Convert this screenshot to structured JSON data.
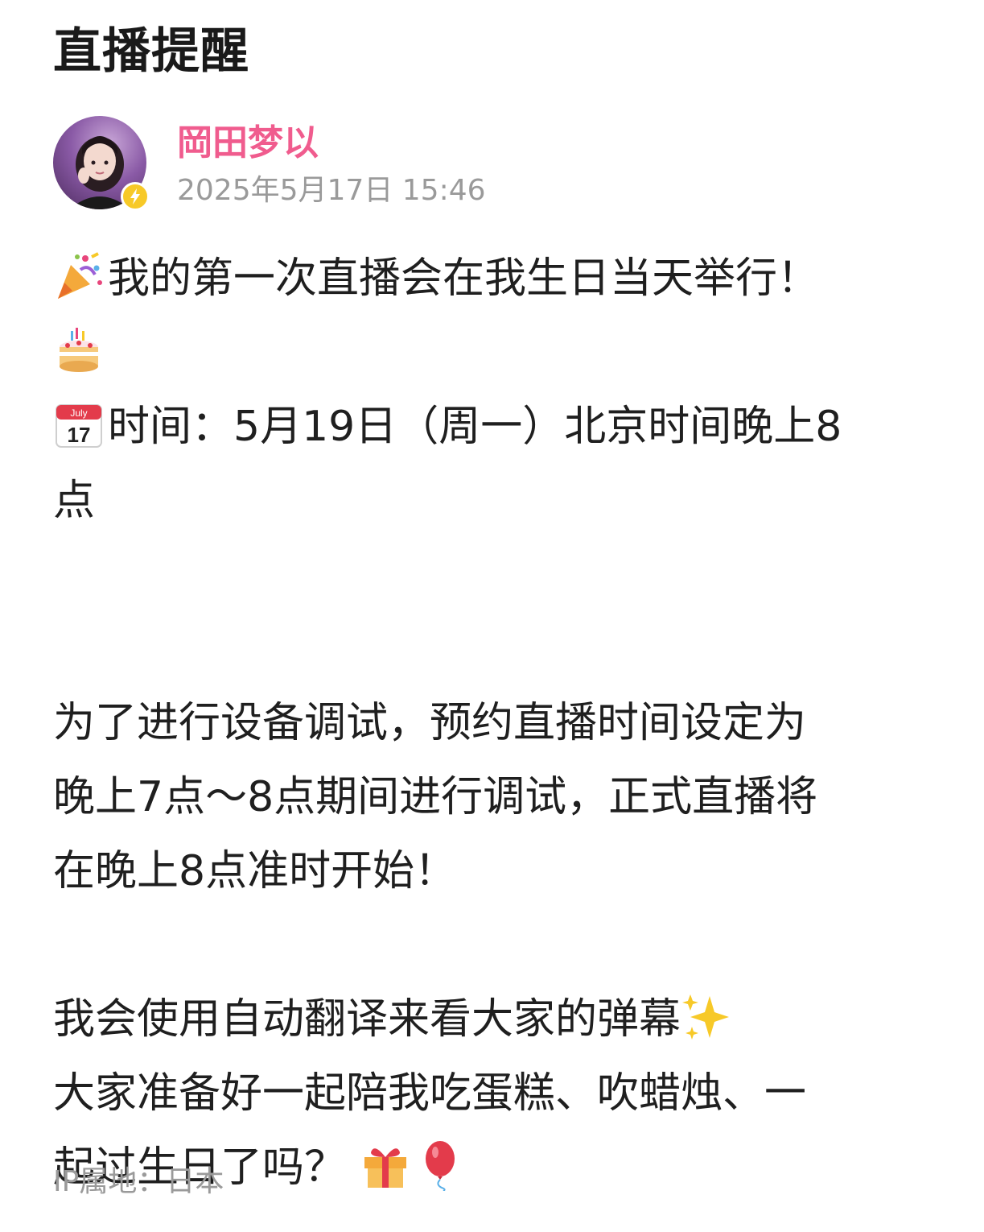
{
  "post": {
    "title": "直播提醒",
    "author": {
      "name": "岡田梦以",
      "timestamp": "2025年5月17日 15:46"
    },
    "content": {
      "line1": "我的第一次直播会在我生日当天举行！",
      "line2_time_a": "时间：5月19日（周一）北京时间晚上8",
      "line2_time_b": "点",
      "para2_a": "为了进行设备调试，预约直播时间设定为",
      "para2_b": "晚上7点～8点期间进行调试，正式直播将",
      "para2_c": "在晚上8点准时开始！",
      "para3_a": "我会使用自动翻译来看大家的弹幕",
      "para3_b": "大家准备好一起陪我吃蛋糕、吹蜡烛、一",
      "para3_c": "起过生日了吗？",
      "calendar_month": "July",
      "calendar_day": "17"
    },
    "ip_location": "IP属地：日本"
  },
  "icons": {
    "party_popper": "party-popper-icon",
    "cake": "birthday-cake-icon",
    "calendar": "calendar-icon",
    "sparkles": "sparkles-icon",
    "gift": "gift-icon",
    "balloon": "balloon-icon",
    "verified": "verified-badge-icon"
  },
  "colors": {
    "author_name": "#f05c8e",
    "muted_text": "#9a9a9a",
    "badge": "#f7c928"
  }
}
